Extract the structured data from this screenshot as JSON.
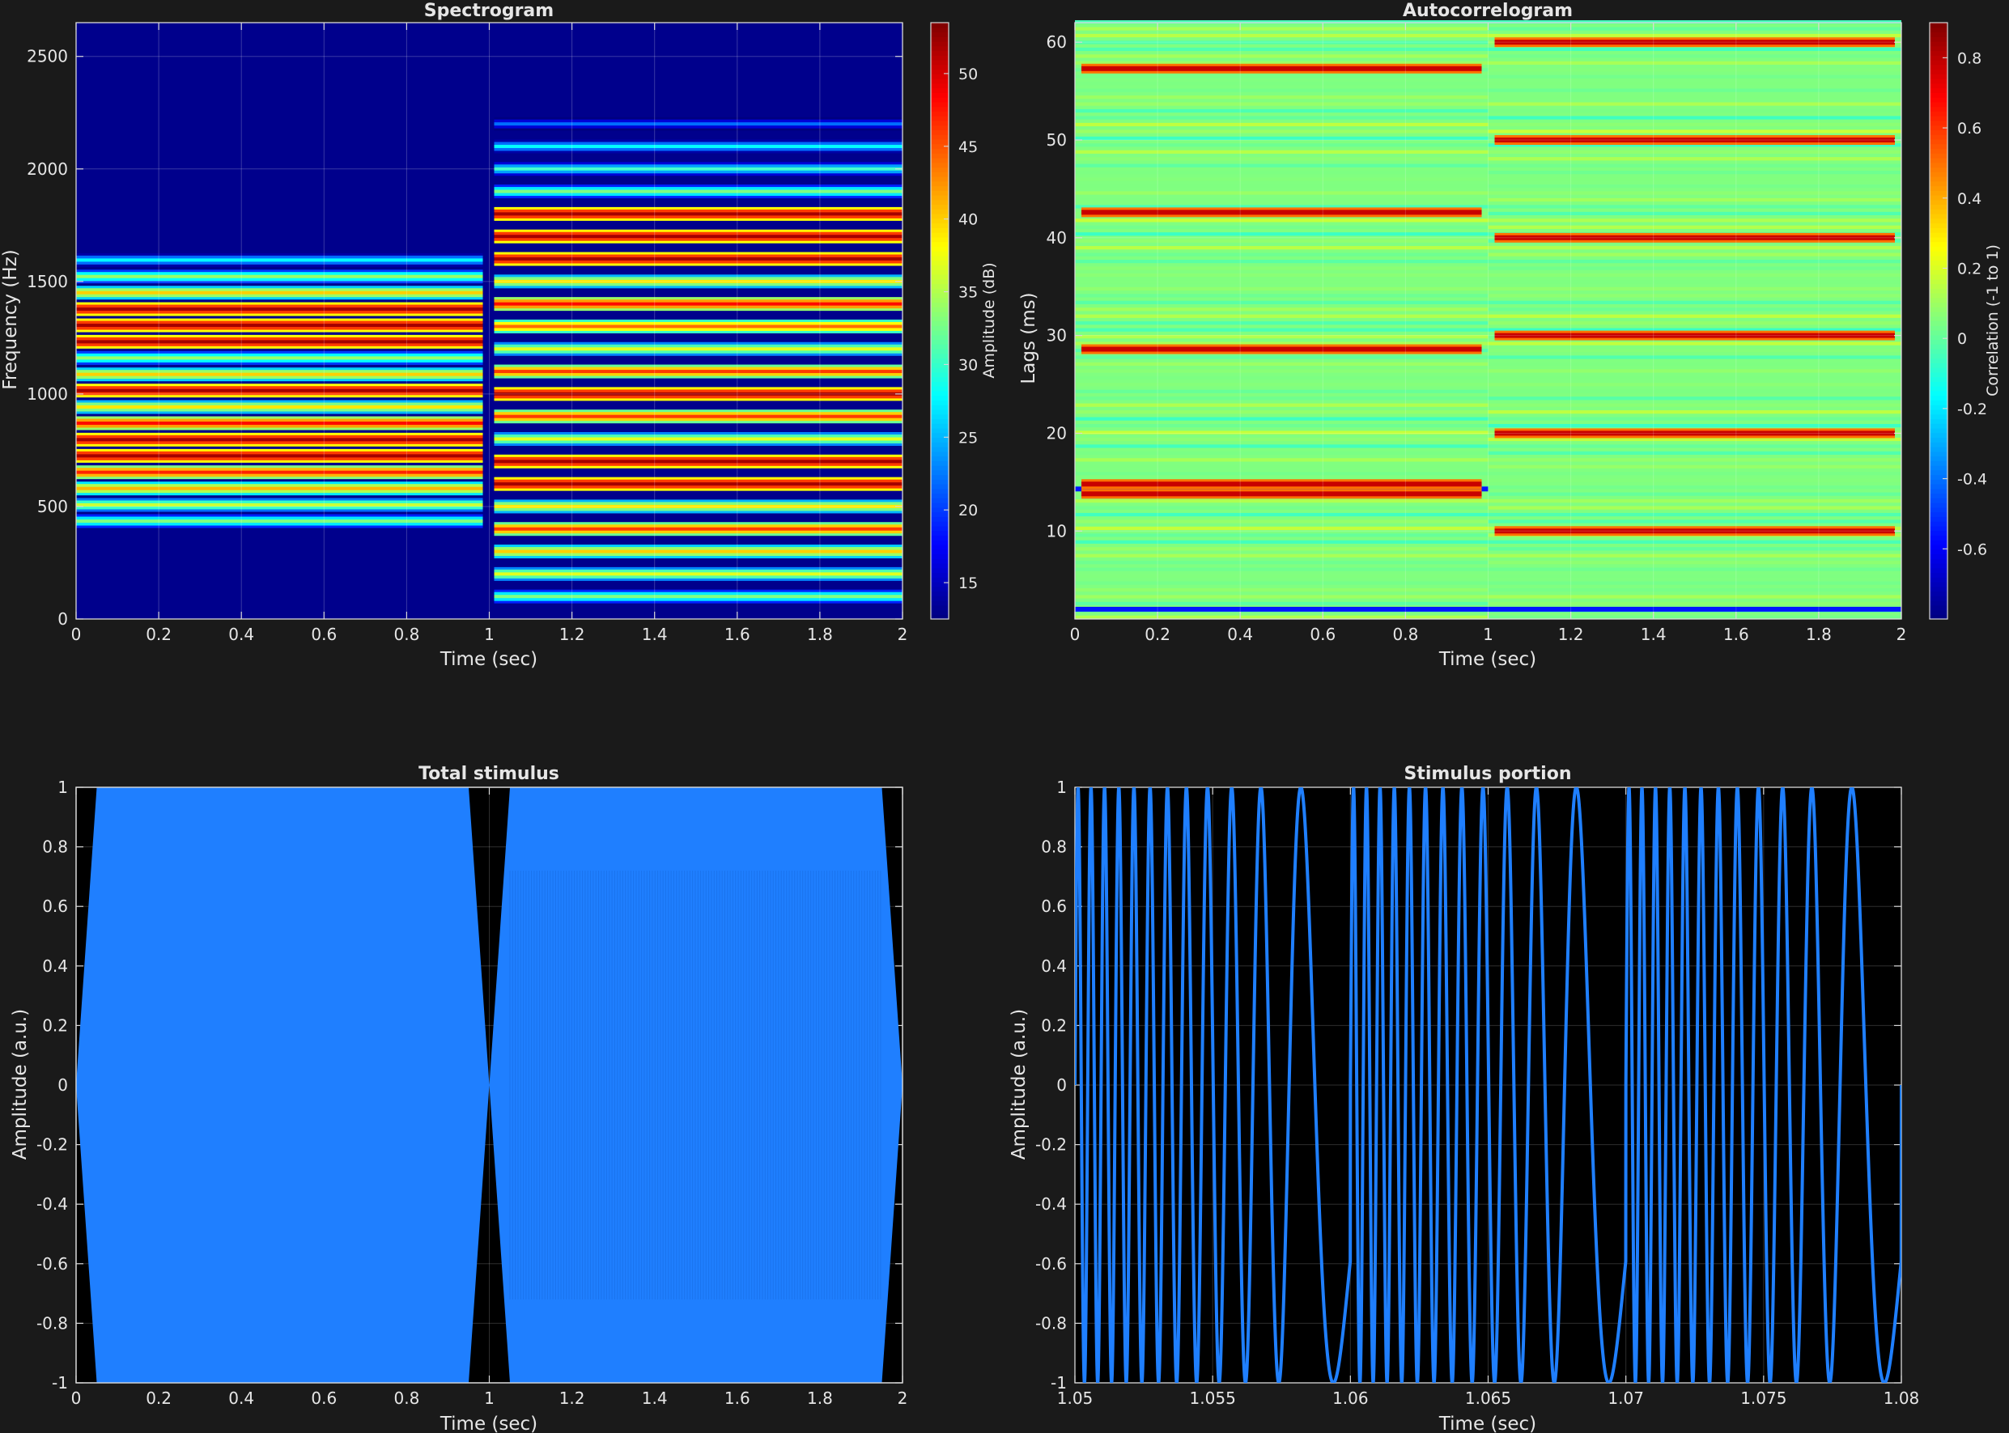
{
  "figure": {
    "background": "#1a1a1a",
    "axes_background": "#000000",
    "axis_color": "#d9d9d9",
    "grid_color": "#ffffff"
  },
  "chart_data": [
    {
      "id": "spectrogram",
      "type": "heatmap",
      "title": "Spectrogram",
      "xlabel": "Time (sec)",
      "ylabel": "Frequency (Hz)",
      "xlim": [
        0,
        2
      ],
      "ylim": [
        0,
        2650
      ],
      "xticks": [
        0,
        0.2,
        0.4,
        0.6,
        0.8,
        1,
        1.2,
        1.4,
        1.6,
        1.8,
        2
      ],
      "xtick_labels": [
        "0",
        "0.2",
        "0.4",
        "0.6",
        "0.8",
        "1",
        "1.2",
        "1.4",
        "1.6",
        "1.8",
        "2"
      ],
      "yticks": [
        0,
        500,
        1000,
        1500,
        2000,
        2500
      ],
      "ytick_labels": [
        "0",
        "500",
        "1000",
        "1500",
        "2000",
        "2500"
      ],
      "colormap": "jet",
      "grid": true,
      "colorbar": {
        "label": "Amplitude (dB)",
        "range": [
          12.5,
          53.5
        ],
        "ticks": [
          15,
          20,
          25,
          30,
          35,
          40,
          45,
          50
        ],
        "tick_labels": [
          "15",
          "20",
          "25",
          "30",
          "35",
          "40",
          "45",
          "50"
        ]
      },
      "segments": [
        {
          "t_start": 0,
          "t_end": 1,
          "component_freqs_hz": [
            435,
            507,
            580,
            652,
            725,
            797,
            870,
            942,
            1015,
            1087,
            1160,
            1232,
            1305,
            1377,
            1450,
            1522,
            1595
          ],
          "component_levels_db": [
            33,
            36,
            41,
            47,
            52,
            52,
            48,
            39,
            52,
            40,
            34,
            52,
            52,
            52,
            40,
            34,
            28
          ]
        },
        {
          "t_start": 1,
          "t_end": 2,
          "component_freqs_hz": [
            100,
            200,
            300,
            400,
            500,
            600,
            700,
            800,
            900,
            1000,
            1100,
            1200,
            1300,
            1400,
            1500,
            1600,
            1700,
            1800,
            1900,
            2000,
            2100,
            2200
          ],
          "component_levels_db": [
            33,
            37,
            40,
            46,
            39,
            52,
            52,
            37,
            46,
            52,
            46,
            37,
            44,
            48,
            39,
            52,
            52,
            52,
            33,
            30,
            28,
            22
          ]
        }
      ]
    },
    {
      "id": "autocorrelogram",
      "type": "heatmap",
      "title": "Autocorrelogram",
      "xlabel": "Time (sec)",
      "ylabel": "Lags (ms)",
      "xlim": [
        0,
        2
      ],
      "ylim": [
        1,
        62
      ],
      "xticks": [
        0,
        0.2,
        0.4,
        0.6,
        0.8,
        1,
        1.2,
        1.4,
        1.6,
        1.8,
        2
      ],
      "xtick_labels": [
        "0",
        "0.2",
        "0.4",
        "0.6",
        "0.8",
        "1",
        "1.2",
        "1.4",
        "1.6",
        "1.8",
        "2"
      ],
      "yticks": [
        10,
        20,
        30,
        40,
        50,
        60
      ],
      "ytick_labels": [
        "10",
        "20",
        "30",
        "40",
        "50",
        "60"
      ],
      "colormap": "jet",
      "grid": true,
      "colorbar": {
        "label": "Correlation (-1 to 1)",
        "range": [
          -0.8,
          0.9
        ],
        "ticks": [
          -0.6,
          -0.4,
          -0.2,
          0,
          0.2,
          0.4,
          0.6,
          0.8
        ],
        "tick_labels": [
          "-0.6",
          "-0.4",
          "-0.2",
          "0",
          "0.2",
          "0.4",
          "0.6",
          "0.8"
        ]
      },
      "segments": [
        {
          "t_start": 0,
          "t_end": 1,
          "peak_lags_ms": [
            13.8,
            14.8,
            28.6,
            42.6,
            57.3
          ],
          "negative_lags_ms": [
            2.0,
            14.3
          ]
        },
        {
          "t_start": 1,
          "t_end": 2,
          "peak_lags_ms": [
            10,
            20,
            30,
            40,
            50,
            60
          ],
          "negative_lags_ms": [
            2.0
          ]
        }
      ]
    },
    {
      "id": "total-stimulus",
      "type": "line",
      "title": "Total stimulus",
      "xlabel": "Time (sec)",
      "ylabel": "Amplitude (a.u.)",
      "xlim": [
        0,
        2
      ],
      "ylim": [
        -1,
        1
      ],
      "xticks": [
        0,
        0.2,
        0.4,
        0.6,
        0.8,
        1,
        1.2,
        1.4,
        1.6,
        1.8,
        2
      ],
      "xtick_labels": [
        "0",
        "0.2",
        "0.4",
        "0.6",
        "0.8",
        "1",
        "1.2",
        "1.4",
        "1.6",
        "1.8",
        "2"
      ],
      "yticks": [
        -1,
        -0.8,
        -0.6,
        -0.4,
        -0.2,
        0,
        0.2,
        0.4,
        0.6,
        0.8,
        1
      ],
      "ytick_labels": [
        "-1",
        "-0.8",
        "-0.6",
        "-0.4",
        "-0.2",
        "0",
        "0.2",
        "0.4",
        "0.6",
        "0.8",
        "1"
      ],
      "grid": true,
      "line_color": "#1f7fff",
      "envelope": {
        "t": [
          0,
          0.05,
          0.95,
          1.0,
          1.05,
          1.95,
          2.0
        ],
        "amplitude": [
          0,
          1,
          1,
          0,
          1,
          1,
          0
        ]
      }
    },
    {
      "id": "stimulus-portion",
      "type": "line",
      "title": "Stimulus portion",
      "xlabel": "Time (sec)",
      "ylabel": "Amplitude (a.u.)",
      "xlim": [
        1.05,
        1.08
      ],
      "ylim": [
        -1,
        1
      ],
      "xticks": [
        1.05,
        1.055,
        1.06,
        1.065,
        1.07,
        1.075,
        1.08
      ],
      "xtick_labels": [
        "1.05",
        "1.055",
        "1.06",
        "1.065",
        "1.07",
        "1.075",
        "1.08"
      ],
      "yticks": [
        -1,
        -0.8,
        -0.6,
        -0.4,
        -0.2,
        0,
        0.2,
        0.4,
        0.6,
        0.8,
        1
      ],
      "ytick_labels": [
        "-1",
        "-0.8",
        "-0.6",
        "-0.4",
        "-0.2",
        "0",
        "0.2",
        "0.4",
        "0.6",
        "0.8",
        "1"
      ],
      "grid": true,
      "line_color": "#1f7fff",
      "signal": {
        "sweep_period_sec": 0.01,
        "start_freq_hz": 2200,
        "end_freq_hz": 180,
        "start_time_sec": 1.05
      }
    }
  ]
}
